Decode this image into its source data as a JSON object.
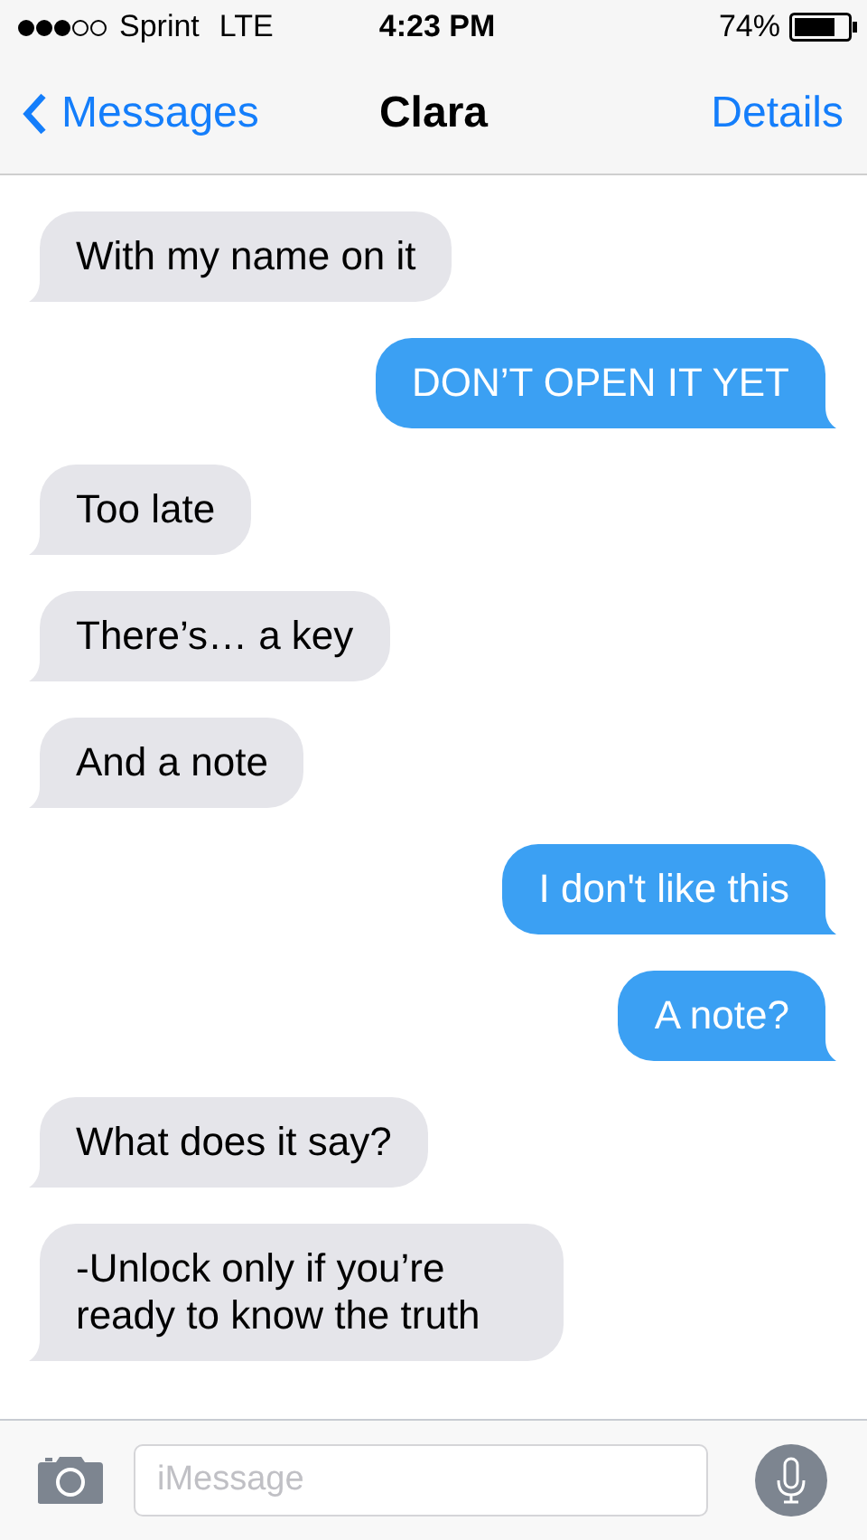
{
  "status_bar": {
    "carrier": "Sprint",
    "network": "LTE",
    "time": "4:23 PM",
    "battery": "74%"
  },
  "nav": {
    "back": "Messages",
    "title": "Clara",
    "action": "Details"
  },
  "messages": [
    {
      "outgoing": false,
      "text": "With my name on it"
    },
    {
      "outgoing": true,
      "text": "DON’T OPEN IT YET"
    },
    {
      "outgoing": false,
      "text": "Too late"
    },
    {
      "outgoing": false,
      "text": "There’s… a key"
    },
    {
      "outgoing": false,
      "text": "And a note"
    },
    {
      "outgoing": true,
      "text": "I don't like this"
    },
    {
      "outgoing": true,
      "text": "A note?"
    },
    {
      "outgoing": false,
      "text": "What does it say?"
    },
    {
      "outgoing": false,
      "text": "-Unlock only if you’re ready to know the truth"
    }
  ],
  "composer": {
    "placeholder": "iMessage"
  }
}
